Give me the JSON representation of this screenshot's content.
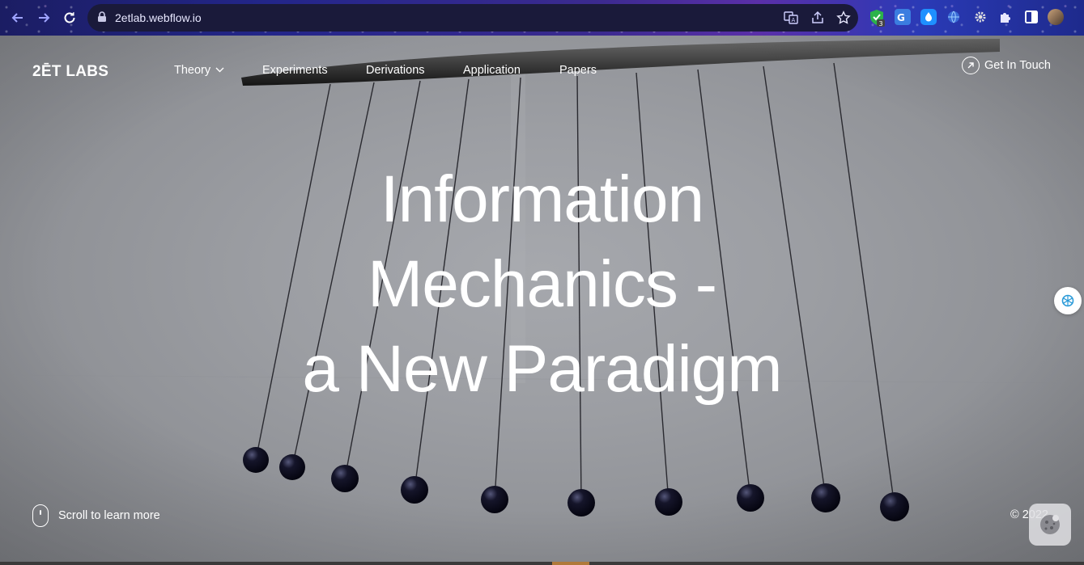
{
  "browser": {
    "url": "2etlab.webflow.io",
    "extension_badge": "3",
    "icons": [
      "back-arrow-icon",
      "forward-arrow-icon",
      "reload-icon",
      "lock-icon",
      "translate-icon",
      "share-icon",
      "bookmark-star-icon",
      "shield-extension-icon",
      "translate-extension-icon",
      "droplet-extension-icon",
      "globe-extension-icon",
      "gear-extension-icon",
      "puzzle-extensions-icon",
      "sidebar-icon",
      "profile-avatar"
    ]
  },
  "site": {
    "logo": "2ĒT LABS",
    "nav": [
      {
        "label": "Theory",
        "has_dropdown": true
      },
      {
        "label": "Experiments"
      },
      {
        "label": "Derivations"
      },
      {
        "label": "Application"
      },
      {
        "label": "Papers"
      }
    ],
    "cta": "Get In Touch",
    "headline": {
      "line1": "Information",
      "line2": "Mechanics -",
      "line3": "a New Paradigm"
    },
    "scroll_hint": "Scroll to learn more",
    "copyright": "© 2022"
  },
  "colors": {
    "hero_bg": "#9c9ea3",
    "text": "#ffffff",
    "browser_frame": "#23268a"
  }
}
